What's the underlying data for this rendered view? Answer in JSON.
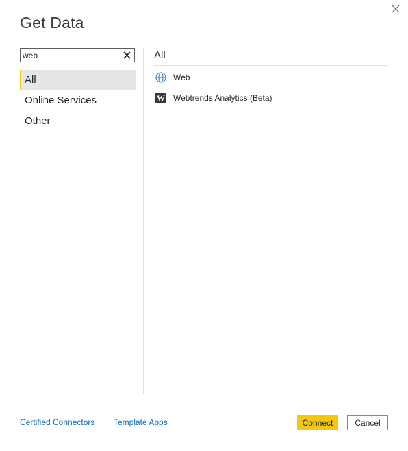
{
  "dialog": {
    "title": "Get Data",
    "close_icon": "close-icon"
  },
  "search": {
    "value": "web",
    "clear_icon": "clear-icon"
  },
  "categories": [
    {
      "label": "All",
      "selected": true
    },
    {
      "label": "Online Services",
      "selected": false
    },
    {
      "label": "Other",
      "selected": false
    }
  ],
  "results": {
    "header": "All",
    "items": [
      {
        "label": "Web",
        "icon": "globe-icon"
      },
      {
        "label": "Webtrends Analytics (Beta)",
        "icon": "webtrends-icon",
        "icon_letter": "W"
      }
    ]
  },
  "footer": {
    "certified_connectors": "Certified Connectors",
    "template_apps": "Template Apps",
    "connect_label": "Connect",
    "cancel_label": "Cancel"
  },
  "colors": {
    "accent": "#f2c811",
    "link": "#106ebe",
    "selected_bg": "#e6e6e6"
  }
}
